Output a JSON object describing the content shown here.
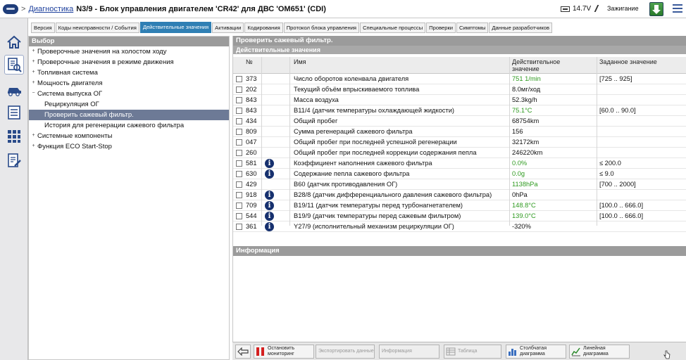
{
  "header": {
    "crumb_link": "Диагностика",
    "crumb_sep": ">",
    "title": "N3/9 - Блок управления двигателем 'CR42' для ДВС 'OM651' (CDI)",
    "voltage": "14.7V",
    "ignition": "Зажигание"
  },
  "tabs": [
    {
      "label": "Версия",
      "active": false
    },
    {
      "label": "Коды неисправности / События",
      "active": false
    },
    {
      "label": "Действительные значения",
      "active": true
    },
    {
      "label": "Активации",
      "active": false
    },
    {
      "label": "Кодирования",
      "active": false
    },
    {
      "label": "Протокол блока управления",
      "active": false
    },
    {
      "label": "Специальные процессы",
      "active": false
    },
    {
      "label": "Проверки",
      "active": false
    },
    {
      "label": "Симптомы",
      "active": false
    },
    {
      "label": "Данные разработчиков",
      "active": false
    }
  ],
  "tree": {
    "title": "Выбор",
    "items": [
      {
        "label": "Проверочные значения на холостом ходу",
        "expander": "+",
        "level": 0
      },
      {
        "label": "Проверочные значения в режиме движения",
        "expander": "+",
        "level": 0
      },
      {
        "label": "Топливная система",
        "expander": "+",
        "level": 0
      },
      {
        "label": "Мощность двигателя",
        "expander": "+",
        "level": 0
      },
      {
        "label": "Система выпуска ОГ",
        "expander": "−",
        "level": 0
      },
      {
        "label": "Рециркуляция ОГ",
        "expander": "",
        "level": 1
      },
      {
        "label": "Проверить сажевый фильтр.",
        "expander": "",
        "level": 1,
        "selected": true
      },
      {
        "label": "История для регенерации сажевого фильтра",
        "expander": "",
        "level": 1
      },
      {
        "label": "Системные компоненты",
        "expander": "+",
        "level": 0
      },
      {
        "label": "Функция ECO Start-Stop",
        "expander": "+",
        "level": 0
      }
    ]
  },
  "main": {
    "title": "Проверить сажевый фильтр.",
    "section": "Действительные значения",
    "columns": {
      "num": "№",
      "name": "Имя",
      "actual": "Действительное значение",
      "setpoint": "Заданное значение"
    },
    "rows": [
      {
        "num": "373",
        "info": false,
        "name": "Число оборотов коленвала двигателя",
        "value": "751 1/min",
        "green": true,
        "setpoint": "[725 .. 925]"
      },
      {
        "num": "202",
        "info": false,
        "name": "Текущий объём впрыскиваемого топлива",
        "value": "8.0мг/ход",
        "green": false,
        "setpoint": ""
      },
      {
        "num": "843",
        "info": false,
        "name": "Масса воздуха",
        "value": "52.3kg/h",
        "green": false,
        "setpoint": ""
      },
      {
        "num": "843",
        "info": false,
        "name": "B11/4 (датчик температуры охлаждающей жидкости)",
        "value": "75.1°C",
        "green": true,
        "setpoint": "[60.0 .. 90.0]"
      },
      {
        "num": "434",
        "info": false,
        "name": "Общий пробег",
        "value": "68754km",
        "green": false,
        "setpoint": ""
      },
      {
        "num": "809",
        "info": false,
        "name": "Сумма регенераций сажевого фильтра",
        "value": "156",
        "green": false,
        "setpoint": ""
      },
      {
        "num": "047",
        "info": false,
        "name": "Общий пробег при последней успешной регенерации",
        "value": "32172km",
        "green": false,
        "setpoint": ""
      },
      {
        "num": "260",
        "info": false,
        "name": "Общий пробег при последней коррекции содержания пепла",
        "value": "246220km",
        "green": false,
        "setpoint": ""
      },
      {
        "num": "581",
        "info": true,
        "name": "Коэффициент наполнения сажевого фильтра",
        "value": "0.0%",
        "green": true,
        "setpoint": "≤ 200.0"
      },
      {
        "num": "630",
        "info": true,
        "name": "Содержание пепла сажевого фильтра",
        "value": "0.0g",
        "green": true,
        "setpoint": "≤ 9.0"
      },
      {
        "num": "429",
        "info": false,
        "name": "B60 (датчик противодавления ОГ)",
        "value": "1138hPa",
        "green": true,
        "setpoint": "[700 .. 2000]"
      },
      {
        "num": "918",
        "info": true,
        "name": "B28/8 (датчик дифференциального давления сажевого фильтра)",
        "value": "0hPa",
        "green": false,
        "setpoint": ""
      },
      {
        "num": "709",
        "info": true,
        "name": "B19/11 (датчик температуры перед турбонагнетателем)",
        "value": "148.8°C",
        "green": true,
        "setpoint": "[100.0 .. 666.0]"
      },
      {
        "num": "544",
        "info": true,
        "name": "B19/9 (датчик температуры перед сажевым фильтром)",
        "value": "139.0°C",
        "green": true,
        "setpoint": "[100.0 .. 666.0]"
      },
      {
        "num": "361",
        "info": true,
        "name": "Y27/9 (исполнительный механизм рециркуляции ОГ)",
        "value": "-320%",
        "green": false,
        "setpoint": ""
      }
    ],
    "info_title": "Информация"
  },
  "toolbar": {
    "stop": "Остановить мониторинг",
    "export": "Экспортировать данные",
    "info": "Информация",
    "table": "Таблица",
    "bar": "Столбчатая диаграмма",
    "line": "Линейная диаграмма"
  },
  "colors": {
    "active_tab": "#2f7fb4",
    "selected_tree": "#6d7a96",
    "panel_header": "#9b9b9b",
    "ok_value": "#2e9a1f",
    "info_icon": "#16306e"
  }
}
